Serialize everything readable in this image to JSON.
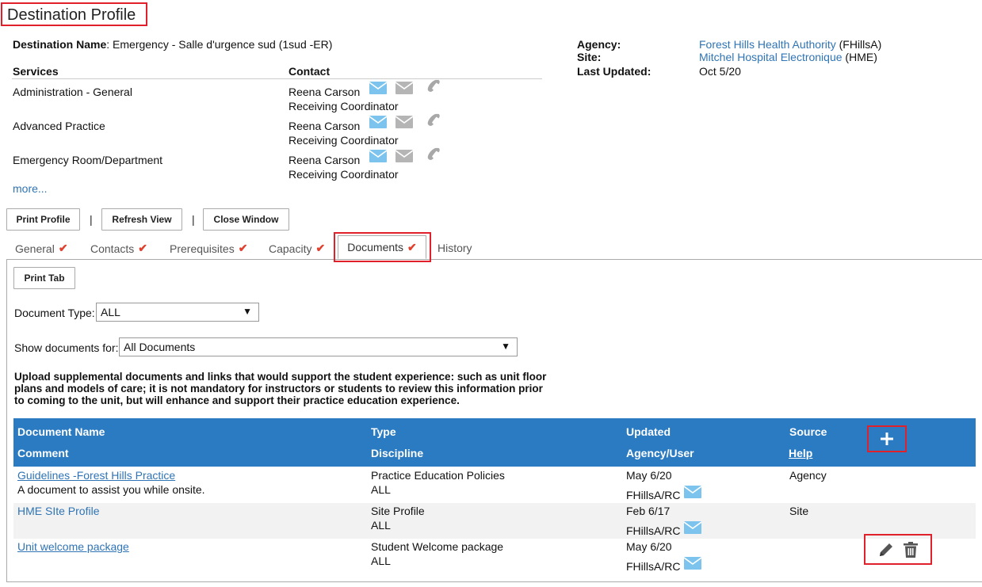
{
  "page_title": "Destination Profile",
  "destination": {
    "name_label": "Destination Name",
    "name_value": "Emergency - Salle d'urgence sud (1sud -ER)"
  },
  "info": {
    "agency_label": "Agency",
    "agency_link": "Forest Hills Health Authority",
    "agency_code": "(FHillsA)",
    "site_label": "Site",
    "site_link": "Mitchel Hospital Electronique",
    "site_code": "(HME)",
    "updated_label": "Last Updated",
    "updated_value": "Oct 5/20"
  },
  "services": {
    "col_services": "Services",
    "col_contact": "Contact",
    "rows": [
      {
        "service": "Administration - General",
        "contact": "Reena Carson",
        "role": "Receiving Coordinator"
      },
      {
        "service": "Advanced Practice",
        "contact": "Reena Carson",
        "role": "Receiving Coordinator"
      },
      {
        "service": "Emergency Room/Department",
        "contact": "Reena Carson",
        "role": "Receiving Coordinator"
      }
    ],
    "more": "more..."
  },
  "toolbar": {
    "print_profile": "Print Profile",
    "refresh_view": "Refresh View",
    "close_window": "Close Window",
    "separator": "|"
  },
  "tabs": {
    "general": "General",
    "contacts": "Contacts",
    "prerequisites": "Prerequisites",
    "capacity": "Capacity",
    "documents": "Documents",
    "history": "History",
    "check": "✔"
  },
  "documents_tab": {
    "print_tab": "Print Tab",
    "doc_type_label": "Document Type:",
    "doc_type_value": "ALL",
    "show_for_label": "Show documents for:",
    "show_for_value": "All Documents",
    "description": "Upload supplemental documents and links that would support the student experience: such as unit floor plans and models of care; it is not mandatory for instructors or students to review this information prior to coming to the unit, but will enhance and support their practice education experience.",
    "headers": {
      "doc_name": "Document Name",
      "comment": "Comment",
      "type": "Type",
      "discipline": "Discipline",
      "updated": "Updated",
      "agency_user": "Agency/User",
      "source": "Source",
      "help": "Help"
    },
    "rows": [
      {
        "name": "Guidelines -Forest Hills Practice",
        "comment": "A document to assist you while onsite.",
        "type": "Practice Education Policies",
        "discipline": "ALL",
        "updated": "May 6/20",
        "user": "FHillsA/RC",
        "source": "Agency"
      },
      {
        "name": "HME SIte Profile",
        "comment": "",
        "type": "Site Profile",
        "discipline": "ALL",
        "updated": "Feb 6/17",
        "user": "FHillsA/RC",
        "source": "Site"
      },
      {
        "name": "Unit welcome package",
        "comment": "",
        "type": "Student Welcome package",
        "discipline": "ALL",
        "updated": "May 6/20",
        "user": "FHillsA/RC",
        "source": ""
      }
    ]
  },
  "colors": {
    "accent_blue": "#2b7bc2",
    "link_blue": "#2f74b5",
    "highlight_red": "#e0202a",
    "check_red": "#e0412f",
    "mail_blue": "#7cc4ee"
  },
  "icons": [
    "mail-blue-icon",
    "mail-grey-icon",
    "phone-icon",
    "plus-icon",
    "pencil-icon",
    "trash-icon",
    "check-icon",
    "dropdown-arrow-icon"
  ]
}
